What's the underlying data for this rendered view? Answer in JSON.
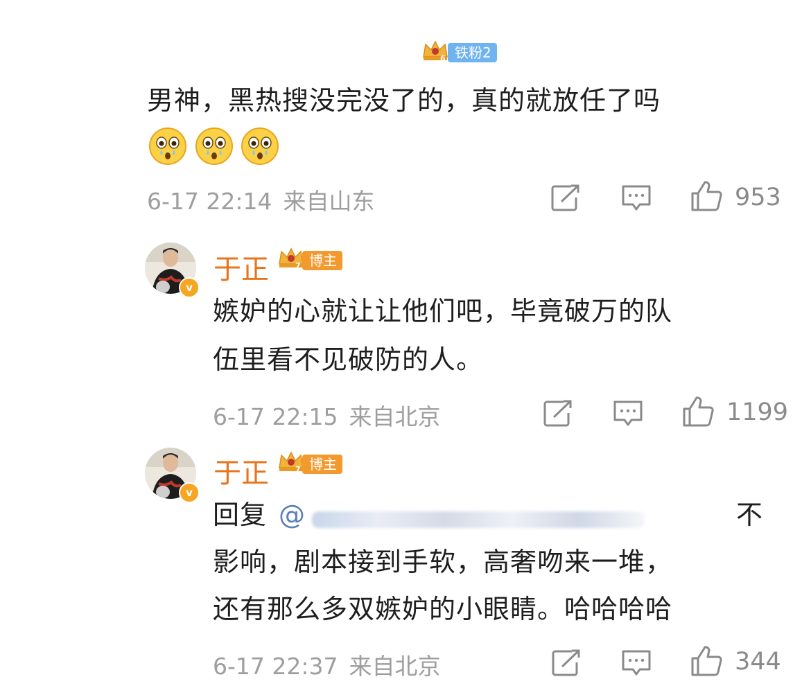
{
  "comments": [
    {
      "fan_badge": "铁粉2",
      "text": "男神，黑热搜没完没了的，真的就放任了吗",
      "emoji_icons": [
        "shocked-crying-emoji",
        "shocked-crying-emoji",
        "shocked-crying-emoji"
      ],
      "date": "6-17 22:14",
      "location": "来自山东",
      "likes": "953"
    },
    {
      "username": "于正",
      "role_badge": "博主",
      "text_line1": "嫉妒的心就让让他们吧，毕竟破万的队",
      "text_line2": "伍里看不见破防的人。",
      "date": "6-17 22:15",
      "location": "来自北京",
      "likes": "1199"
    },
    {
      "username": "于正",
      "role_badge": "博主",
      "reply_prefix": "回复",
      "mention_at": "@",
      "text_tail": "不",
      "text_line2": "影响，剧本接到手软，高奢吻来一堆，",
      "text_line3": "还有那么多双嫉妒的小眼睛。哈哈哈哈",
      "date": "6-17 22:37",
      "location": "来自北京",
      "likes": "344"
    }
  ],
  "icons": {
    "share": "share-icon",
    "comment": "comment-icon",
    "like": "thumbs-up-icon",
    "crown": "crown-icon",
    "verified": "verified-v-icon"
  },
  "colors": {
    "username": "#e8741c",
    "meta": "#9e9e9e",
    "fan_badge_bg": "#6fb3f0",
    "host_badge_bg": "#f29a2e"
  }
}
